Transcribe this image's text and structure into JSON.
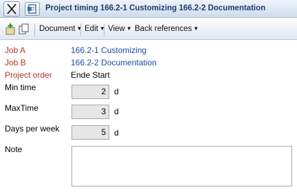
{
  "window": {
    "title": "Project timing 166.2-1 Customizing 166.2-2 Documentation"
  },
  "toolbar": {
    "icons": [
      "add-icon",
      "copy-icon"
    ],
    "menus": [
      "Document",
      "Edit",
      "View",
      "Back references"
    ]
  },
  "form": {
    "job_a": {
      "label": "Job A",
      "value": "166.2-1 Customizing"
    },
    "job_b": {
      "label": "Job B",
      "value": "166.2-2 Documentation"
    },
    "project_order": {
      "label": "Project order",
      "value": "Ende Start"
    },
    "min_time": {
      "label": "Min time",
      "value": "2",
      "unit": "d"
    },
    "max_time": {
      "label": "MaxTime",
      "value": "3",
      "unit": "d"
    },
    "days_per_week": {
      "label": "Days per week",
      "value": "5",
      "unit": "d"
    },
    "note": {
      "label": "Note",
      "value": ""
    }
  },
  "colors": {
    "label_required": "#b5322a",
    "link": "#1c4aa8",
    "title": "#1f3d6b"
  }
}
